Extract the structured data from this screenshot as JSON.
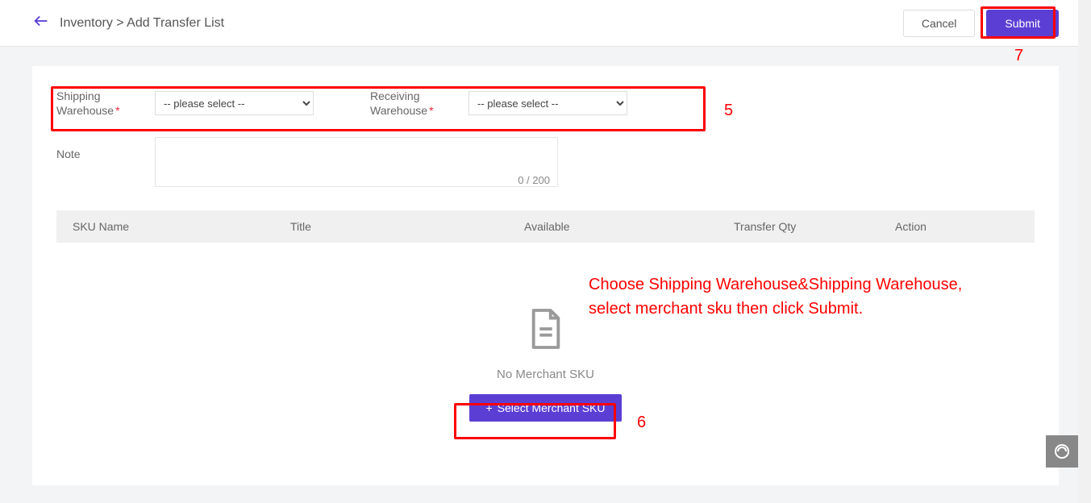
{
  "topbar": {
    "breadcrumb_part1": "Inventory",
    "breadcrumb_sep": ">",
    "breadcrumb_part2": "Add Transfer List",
    "cancel": "Cancel",
    "submit": "Submit"
  },
  "form": {
    "shipping_label": "Shipping Warehouse",
    "receiving_label": "Receiving Warehouse",
    "please_select": "-- please select --",
    "note_label": "Note",
    "note_count": "0 / 200"
  },
  "table": {
    "col_sku": "SKU Name",
    "col_title": "Title",
    "col_available": "Available",
    "col_qty": "Transfer Qty",
    "col_action": "Action"
  },
  "empty": {
    "message": "No Merchant SKU",
    "button": "Select Merchant SKU",
    "plus": "+"
  },
  "annotations": {
    "n5": "5",
    "n6": "6",
    "n7": "7",
    "help_line1": "Choose Shipping Warehouse&Shipping Warehouse,",
    "help_line2": "select merchant sku then click Submit."
  }
}
